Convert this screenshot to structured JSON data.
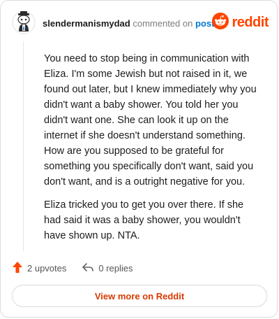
{
  "header": {
    "username": "slendermanismydad",
    "commented_text": "commented on",
    "post_link": "post",
    "brand": "reddit"
  },
  "comment": {
    "paragraphs": [
      "You need to stop being in communication with Eliza. I'm some Jewish but not raised in it, we found out later, but I knew immediately why you didn't want a baby shower. You told her you didn't want one. She can look it up on the internet if she doesn't understand something. How are you supposed to be grateful for something you specifically don't want, said you don't want, and is a outright negative for you.",
      "Eliza tricked you to get you over there. If she had said it was a baby shower, you wouldn't have shown up. NTA."
    ]
  },
  "actions": {
    "upvotes": "2 upvotes",
    "replies": "0 replies"
  },
  "footer": {
    "view_button": "View more on Reddit"
  },
  "colors": {
    "brand": "#ff4500",
    "link": "#0079d3",
    "button_text": "#d93a00"
  },
  "icons": [
    "snoo-avatar-icon",
    "reddit-logo-icon",
    "upvote-arrow-icon",
    "reply-icon"
  ]
}
